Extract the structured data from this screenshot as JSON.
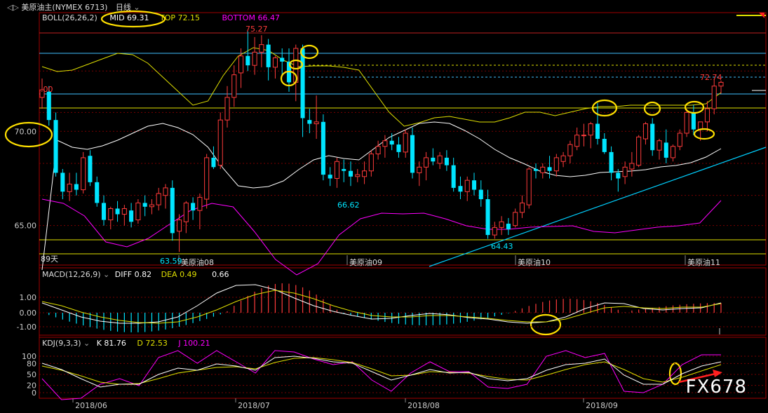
{
  "window": {
    "title": "美原油主(NYMEX 6713)",
    "period": "日线"
  },
  "colors": {
    "up": "#ff3b3b",
    "down": "#00e5ff",
    "mid": "#ffffff",
    "upper": "#e0e000",
    "lower": "#ff00ff",
    "grid": "#7a0000",
    "annot": "#ffe000",
    "trend": "#00d0ff"
  },
  "main": {
    "indicator": "BOLL(26,26,2)",
    "mid_label": "MID 69.31",
    "top_label": "TOP 72.15",
    "bottom_label": "BOTTOM 66.47",
    "y_ticks": [
      "70.00",
      "65.00"
    ],
    "left_marker": ".00",
    "days_label": "89天",
    "contract_labels": [
      "美原油08",
      "美原油09",
      "美原油10",
      "美原油11"
    ],
    "annotations": [
      "75.27",
      "72.74",
      "66.62",
      "64.43",
      "63.59"
    ]
  },
  "macd": {
    "indicator": "MACD(12,26,9)",
    "diff_label": "DIFF 0.82",
    "dea_label": "DEA 0.49",
    "macd_label": "0.66",
    "y_ticks": [
      "1.00",
      "0.00",
      "-1.00"
    ]
  },
  "kdj": {
    "indicator": "KDJ(9,3,3)",
    "k_label": "K 81.76",
    "d_label": "D 72.53",
    "j_label": "J 100.21",
    "y_ticks": [
      "100",
      "80",
      "50",
      "20",
      "0"
    ]
  },
  "x_axis": {
    "labels": [
      "2018/06",
      "2018/07",
      "2018/08",
      "2018/09"
    ]
  },
  "watermark": "FX678",
  "chart_data": {
    "type": "candlestick",
    "ylim": [
      63.5,
      76.0
    ],
    "hlines": [
      75.27,
      74.6,
      72.74,
      72.0,
      70.0,
      63.59,
      64.43
    ],
    "candles": [
      [
        71.8,
        72.8,
        71.2,
        72.2
      ],
      [
        72.1,
        72.4,
        70.3,
        70.6
      ],
      [
        70.6,
        71.0,
        67.6,
        67.8
      ],
      [
        67.8,
        68.0,
        66.4,
        66.8
      ],
      [
        66.8,
        67.8,
        66.3,
        67.2
      ],
      [
        67.2,
        67.8,
        66.6,
        66.9
      ],
      [
        66.9,
        68.9,
        66.7,
        68.6
      ],
      [
        68.7,
        69.0,
        67.1,
        67.3
      ],
      [
        67.3,
        67.6,
        66.0,
        66.2
      ],
      [
        66.2,
        66.6,
        65.0,
        65.3
      ],
      [
        65.3,
        66.0,
        64.8,
        65.9
      ],
      [
        65.9,
        66.3,
        65.2,
        65.6
      ],
      [
        65.6,
        66.1,
        65.0,
        65.9
      ],
      [
        65.8,
        66.2,
        64.9,
        65.2
      ],
      [
        65.3,
        66.4,
        65.1,
        66.2
      ],
      [
        66.2,
        66.6,
        65.5,
        66.0
      ],
      [
        66.0,
        66.4,
        65.6,
        66.1
      ],
      [
        66.1,
        67.0,
        65.8,
        66.7
      ],
      [
        66.6,
        67.2,
        65.9,
        67.0
      ],
      [
        67.0,
        67.4,
        64.2,
        64.6
      ],
      [
        64.7,
        65.6,
        63.6,
        65.3
      ],
      [
        65.2,
        66.3,
        64.6,
        66.2
      ],
      [
        66.2,
        66.5,
        65.3,
        65.8
      ],
      [
        65.8,
        66.7,
        64.8,
        66.5
      ],
      [
        66.4,
        68.8,
        65.9,
        68.6
      ],
      [
        68.6,
        69.2,
        68.0,
        68.1
      ],
      [
        68.2,
        71.0,
        68.0,
        70.6
      ],
      [
        70.6,
        72.4,
        70.2,
        71.8
      ],
      [
        71.8,
        73.5,
        71.3,
        73.0
      ],
      [
        73.1,
        74.4,
        72.3,
        74.0
      ],
      [
        74.0,
        75.3,
        73.2,
        73.5
      ],
      [
        73.5,
        75.0,
        73.0,
        74.2
      ],
      [
        74.2,
        75.1,
        73.4,
        74.6
      ],
      [
        74.6,
        74.9,
        72.7,
        73.4
      ],
      [
        73.4,
        74.0,
        72.8,
        73.9
      ],
      [
        73.9,
        74.4,
        73.0,
        73.7
      ],
      [
        73.7,
        74.4,
        72.1,
        72.6
      ],
      [
        72.6,
        74.6,
        71.6,
        74.4
      ],
      [
        74.4,
        74.6,
        69.7,
        70.7
      ],
      [
        70.6,
        71.2,
        69.9,
        70.4
      ],
      [
        70.4,
        71.9,
        69.6,
        70.5
      ],
      [
        70.5,
        70.9,
        67.4,
        67.7
      ],
      [
        67.7,
        68.1,
        67.1,
        67.5
      ],
      [
        67.5,
        68.6,
        67.0,
        68.4
      ],
      [
        68.0,
        68.5,
        67.3,
        67.9
      ],
      [
        67.9,
        68.4,
        67.1,
        67.6
      ],
      [
        67.6,
        68.0,
        67.3,
        67.7
      ],
      [
        67.6,
        68.4,
        67.2,
        67.9
      ],
      [
        67.9,
        69.0,
        67.6,
        68.8
      ],
      [
        68.8,
        69.5,
        68.5,
        69.2
      ],
      [
        69.2,
        69.8,
        68.6,
        69.5
      ],
      [
        69.5,
        69.9,
        69.0,
        69.3
      ],
      [
        69.3,
        69.7,
        68.6,
        68.9
      ],
      [
        68.9,
        70.1,
        68.6,
        69.9
      ],
      [
        69.8,
        70.2,
        67.5,
        67.8
      ],
      [
        67.8,
        68.4,
        67.1,
        68.1
      ],
      [
        68.1,
        68.9,
        67.4,
        68.6
      ],
      [
        68.6,
        69.1,
        68.2,
        68.4
      ],
      [
        68.3,
        68.9,
        68.0,
        68.7
      ],
      [
        68.6,
        69.0,
        67.9,
        68.2
      ],
      [
        68.2,
        68.6,
        66.8,
        67.0
      ],
      [
        67.1,
        67.6,
        66.4,
        66.8
      ],
      [
        66.8,
        67.6,
        66.3,
        67.4
      ],
      [
        67.4,
        67.8,
        66.6,
        66.9
      ],
      [
        66.9,
        67.4,
        66.0,
        66.4
      ],
      [
        66.4,
        66.9,
        64.3,
        64.5
      ],
      [
        64.5,
        65.2,
        64.3,
        64.9
      ],
      [
        64.9,
        65.5,
        64.5,
        65.2
      ],
      [
        65.1,
        65.4,
        64.5,
        64.8
      ],
      [
        65.0,
        65.9,
        64.9,
        65.7
      ],
      [
        65.7,
        66.6,
        65.4,
        66.2
      ],
      [
        66.1,
        68.1,
        65.9,
        68.0
      ],
      [
        68.0,
        68.3,
        67.5,
        67.9
      ],
      [
        67.8,
        68.3,
        67.5,
        68.1
      ],
      [
        68.1,
        68.7,
        67.5,
        67.9
      ],
      [
        67.9,
        68.8,
        67.6,
        68.6
      ],
      [
        68.4,
        68.9,
        68.1,
        68.7
      ],
      [
        68.7,
        69.5,
        68.3,
        69.3
      ],
      [
        69.2,
        70.2,
        69.0,
        69.8
      ],
      [
        69.8,
        70.4,
        69.2,
        69.8
      ],
      [
        69.8,
        70.5,
        69.1,
        70.4
      ],
      [
        70.4,
        71.5,
        69.3,
        69.6
      ],
      [
        69.6,
        69.9,
        68.8,
        68.9
      ],
      [
        68.9,
        69.2,
        67.4,
        67.8
      ],
      [
        67.8,
        68.0,
        66.8,
        67.5
      ],
      [
        67.6,
        68.4,
        67.2,
        68.1
      ],
      [
        68.0,
        68.9,
        67.6,
        68.3
      ],
      [
        68.2,
        69.8,
        68.1,
        69.7
      ],
      [
        69.6,
        70.5,
        69.3,
        70.4
      ],
      [
        70.4,
        70.7,
        68.7,
        69.0
      ],
      [
        69.0,
        69.6,
        68.5,
        69.5
      ],
      [
        69.4,
        70.1,
        68.3,
        68.6
      ],
      [
        68.6,
        69.3,
        68.4,
        69.2
      ],
      [
        69.2,
        70.1,
        69.0,
        69.9
      ],
      [
        69.9,
        71.2,
        69.7,
        71.0
      ],
      [
        71.0,
        71.4,
        69.8,
        70.1
      ],
      [
        70.1,
        70.5,
        69.5,
        70.5
      ],
      [
        70.5,
        71.6,
        70.0,
        71.2
      ],
      [
        71.2,
        72.8,
        70.9,
        72.4
      ],
      [
        72.4,
        72.7,
        72.0,
        72.6
      ]
    ],
    "boll_mid_y": [
      385,
      200,
      210,
      213,
      208,
      200,
      190,
      180,
      176,
      182,
      192,
      210,
      240,
      265,
      268,
      266,
      258,
      242,
      228,
      222,
      226,
      228,
      212,
      196,
      186,
      176,
      174,
      176,
      186,
      198,
      213,
      225,
      234,
      244,
      250,
      252,
      250,
      246,
      245,
      244,
      242,
      238,
      236,
      232,
      224,
      212
    ],
    "boll_upper_y": [
      95,
      102,
      100,
      92,
      84,
      76,
      78,
      90,
      110,
      130,
      150,
      144,
      108,
      80,
      68,
      72,
      86,
      95,
      94,
      94,
      96,
      100,
      130,
      160,
      180,
      175,
      168,
      166,
      170,
      174,
      174,
      168,
      160,
      160,
      165,
      160,
      155,
      152,
      152,
      150,
      150,
      150,
      150,
      150,
      148,
      132
    ],
    "boll_lower_y": [
      284,
      290,
      308,
      345,
      352,
      340,
      320,
      300,
      290,
      295,
      330,
      370,
      392,
      376,
      335,
      312,
      304,
      305,
      304,
      312,
      322,
      327,
      327,
      324,
      323,
      322,
      330,
      332,
      328,
      324,
      322,
      318,
      286
    ],
    "macd_diff_y": [
      432,
      442,
      452,
      458,
      461,
      461,
      459,
      452,
      436,
      418,
      407,
      406,
      413,
      425,
      436,
      444,
      450,
      455,
      454,
      450,
      447,
      449,
      453,
      455,
      459,
      461,
      459,
      452,
      440,
      432,
      433,
      440,
      442,
      440,
      439,
      432
    ],
    "macd_dea_y": [
      430,
      436,
      445,
      452,
      457,
      460,
      461,
      459,
      452,
      442,
      430,
      420,
      414,
      418,
      426,
      436,
      444,
      450,
      452,
      452,
      450,
      450,
      452,
      454,
      457,
      459,
      459,
      455,
      447,
      439,
      437,
      439,
      440,
      438,
      438,
      433
    ],
    "kdj_k_y": [
      518,
      527,
      540,
      552,
      548,
      548,
      534,
      525,
      528,
      519,
      522,
      528,
      510,
      508,
      511,
      516,
      518,
      530,
      542,
      535,
      527,
      532,
      531,
      540,
      543,
      540,
      528,
      520,
      518,
      512,
      535,
      548,
      548,
      533,
      522,
      516
    ],
    "kdj_d_y": [
      522,
      528,
      536,
      545,
      548,
      547,
      540,
      532,
      528,
      524,
      523,
      526,
      517,
      511,
      510,
      513,
      517,
      526,
      536,
      535,
      530,
      531,
      532,
      537,
      541,
      542,
      535,
      527,
      520,
      516,
      527,
      540,
      545,
      538,
      529,
      520
    ],
    "kdj_j_y": [
      540,
      570,
      568,
      548,
      540,
      550,
      510,
      500,
      518,
      500,
      516,
      532,
      500,
      502,
      512,
      520,
      516,
      542,
      558,
      532,
      516,
      530,
      530,
      552,
      554,
      548,
      508,
      500,
      510,
      504,
      558,
      560,
      548,
      520,
      506,
      506
    ]
  }
}
